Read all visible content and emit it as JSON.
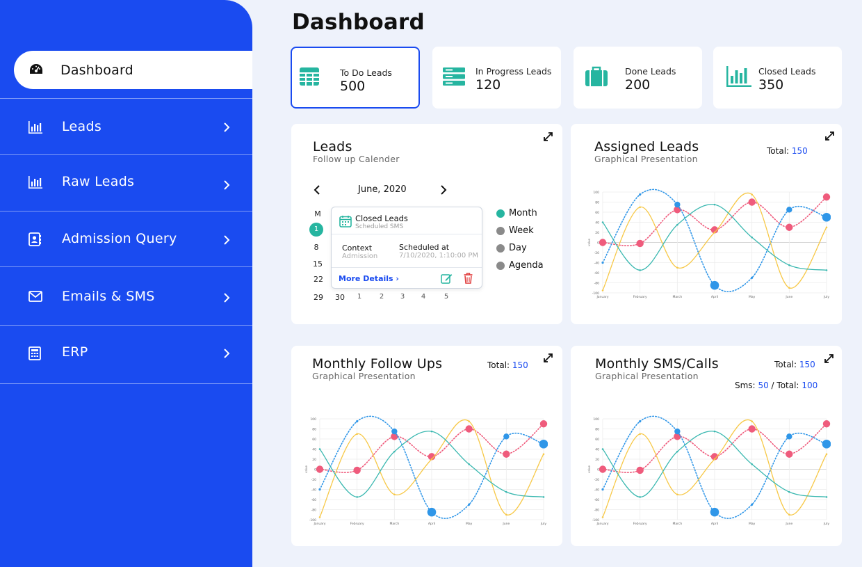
{
  "sidebar": {
    "active": {
      "label": "Dashboard",
      "icon": "speedometer-icon"
    },
    "items": [
      {
        "label": "Leads",
        "icon": "bar-chart-icon"
      },
      {
        "label": "Raw Leads",
        "icon": "bar-chart-icon"
      },
      {
        "label": "Admission Query",
        "icon": "contact-book-icon"
      },
      {
        "label": "Emails & SMS",
        "icon": "envelope-icon"
      },
      {
        "label": "ERP",
        "icon": "calculator-icon"
      }
    ]
  },
  "header": {
    "title": "Dashboard"
  },
  "stats": [
    {
      "label": "To Do Leads",
      "value": "500",
      "icon": "table-icon"
    },
    {
      "label": "In Progress Leads",
      "value": "120",
      "icon": "server-icon"
    },
    {
      "label": "Done Leads",
      "value": "200",
      "icon": "briefcase-icon"
    },
    {
      "label": "Closed Leads",
      "value": "350",
      "icon": "bar-chart-icon"
    }
  ],
  "calendar_panel": {
    "title": "Leads",
    "subtitle": "Follow up Calender",
    "month": "June, 2020",
    "day_header": "M",
    "days": [
      "1",
      "8",
      "15",
      "22",
      "29",
      "30",
      "1",
      "2",
      "3",
      "4",
      "5"
    ],
    "legend": [
      "Month",
      "Week",
      "Day",
      "Agenda"
    ],
    "popup": {
      "title": "Closed Leads",
      "subtitle": "Scheduled SMS",
      "context_label": "Context",
      "context_value": "Admission",
      "scheduled_label": "Scheduled at",
      "scheduled_value": "7/10/2020, 1:10:00 PM",
      "more": "More Details"
    }
  },
  "assigned_panel": {
    "title": "Assigned Leads",
    "subtitle": "Graphical Presentation",
    "total_label": "Total:",
    "total_value": "150"
  },
  "followups_panel": {
    "title": "Monthly Follow Ups",
    "subtitle": "Graphical Presentation",
    "total_label": "Total:",
    "total_value": "150"
  },
  "sms_panel": {
    "title": "Monthly SMS/Calls",
    "subtitle": "Graphical Presentation",
    "total_label": "Total:",
    "total_value": "150",
    "sms_label": "Sms:",
    "sms_value": "50",
    "sms_total_label": "/ Total:",
    "sms_total_value": "100"
  },
  "colors": {
    "primary": "#1a4bf0",
    "teal": "#26b5a0",
    "yellow": "#f7c846",
    "pink": "#ef5b7c",
    "blue": "#2f96e8",
    "cyan": "#3ab8b0",
    "red": "#e03b3b"
  },
  "chart_data": [
    {
      "type": "line",
      "categories": [
        "January",
        "February",
        "March",
        "April",
        "May",
        "June",
        "July"
      ],
      "ylim": [
        -100,
        100
      ],
      "yticks": [
        "100",
        "80",
        "60",
        "40",
        "20",
        "0",
        "-20",
        "-40",
        "-60",
        "-80",
        "-100"
      ],
      "ylabel": "value",
      "series": [
        {
          "values": [
            0,
            -2,
            65,
            25,
            80,
            30,
            90
          ],
          "color": "#ef5b7c",
          "style": "dotted"
        },
        {
          "values": [
            -40,
            95,
            75,
            -85,
            -70,
            65,
            50
          ],
          "color": "#2f96e8",
          "style": "dotted"
        },
        {
          "values": [
            -95,
            70,
            -50,
            20,
            95,
            -90,
            30
          ],
          "color": "#f7c846",
          "style": "solid"
        },
        {
          "values": [
            40,
            -55,
            35,
            75,
            10,
            -45,
            -55
          ],
          "color": "#3ab8b0",
          "style": "solid"
        }
      ]
    },
    {
      "type": "line",
      "categories": [
        "January",
        "February",
        "March",
        "April",
        "May",
        "June",
        "July"
      ],
      "ylim": [
        -100,
        100
      ],
      "yticks": [
        "100",
        "80",
        "60",
        "40",
        "20",
        "0",
        "-20",
        "-40",
        "-60",
        "-80",
        "-100"
      ],
      "ylabel": "value",
      "series": [
        {
          "values": [
            0,
            -2,
            65,
            25,
            80,
            30,
            90
          ],
          "color": "#ef5b7c",
          "style": "dotted"
        },
        {
          "values": [
            -40,
            95,
            75,
            -85,
            -70,
            65,
            50
          ],
          "color": "#2f96e8",
          "style": "dotted"
        },
        {
          "values": [
            -95,
            70,
            -50,
            20,
            95,
            -90,
            30
          ],
          "color": "#f7c846",
          "style": "solid"
        },
        {
          "values": [
            40,
            -55,
            35,
            75,
            10,
            -45,
            -55
          ],
          "color": "#3ab8b0",
          "style": "solid"
        }
      ]
    },
    {
      "type": "line",
      "categories": [
        "January",
        "February",
        "March",
        "April",
        "May",
        "June",
        "July"
      ],
      "ylim": [
        -100,
        100
      ],
      "yticks": [
        "100",
        "80",
        "60",
        "40",
        "20",
        "0",
        "-20",
        "-40",
        "-60",
        "-80",
        "-100"
      ],
      "ylabel": "value",
      "series": [
        {
          "values": [
            0,
            -2,
            65,
            25,
            80,
            30,
            90
          ],
          "color": "#ef5b7c",
          "style": "dotted"
        },
        {
          "values": [
            -40,
            95,
            75,
            -85,
            -70,
            65,
            50
          ],
          "color": "#2f96e8",
          "style": "dotted"
        },
        {
          "values": [
            -95,
            70,
            -50,
            20,
            95,
            -90,
            30
          ],
          "color": "#f7c846",
          "style": "solid"
        },
        {
          "values": [
            40,
            -55,
            35,
            75,
            10,
            -45,
            -55
          ],
          "color": "#3ab8b0",
          "style": "solid"
        }
      ]
    }
  ]
}
